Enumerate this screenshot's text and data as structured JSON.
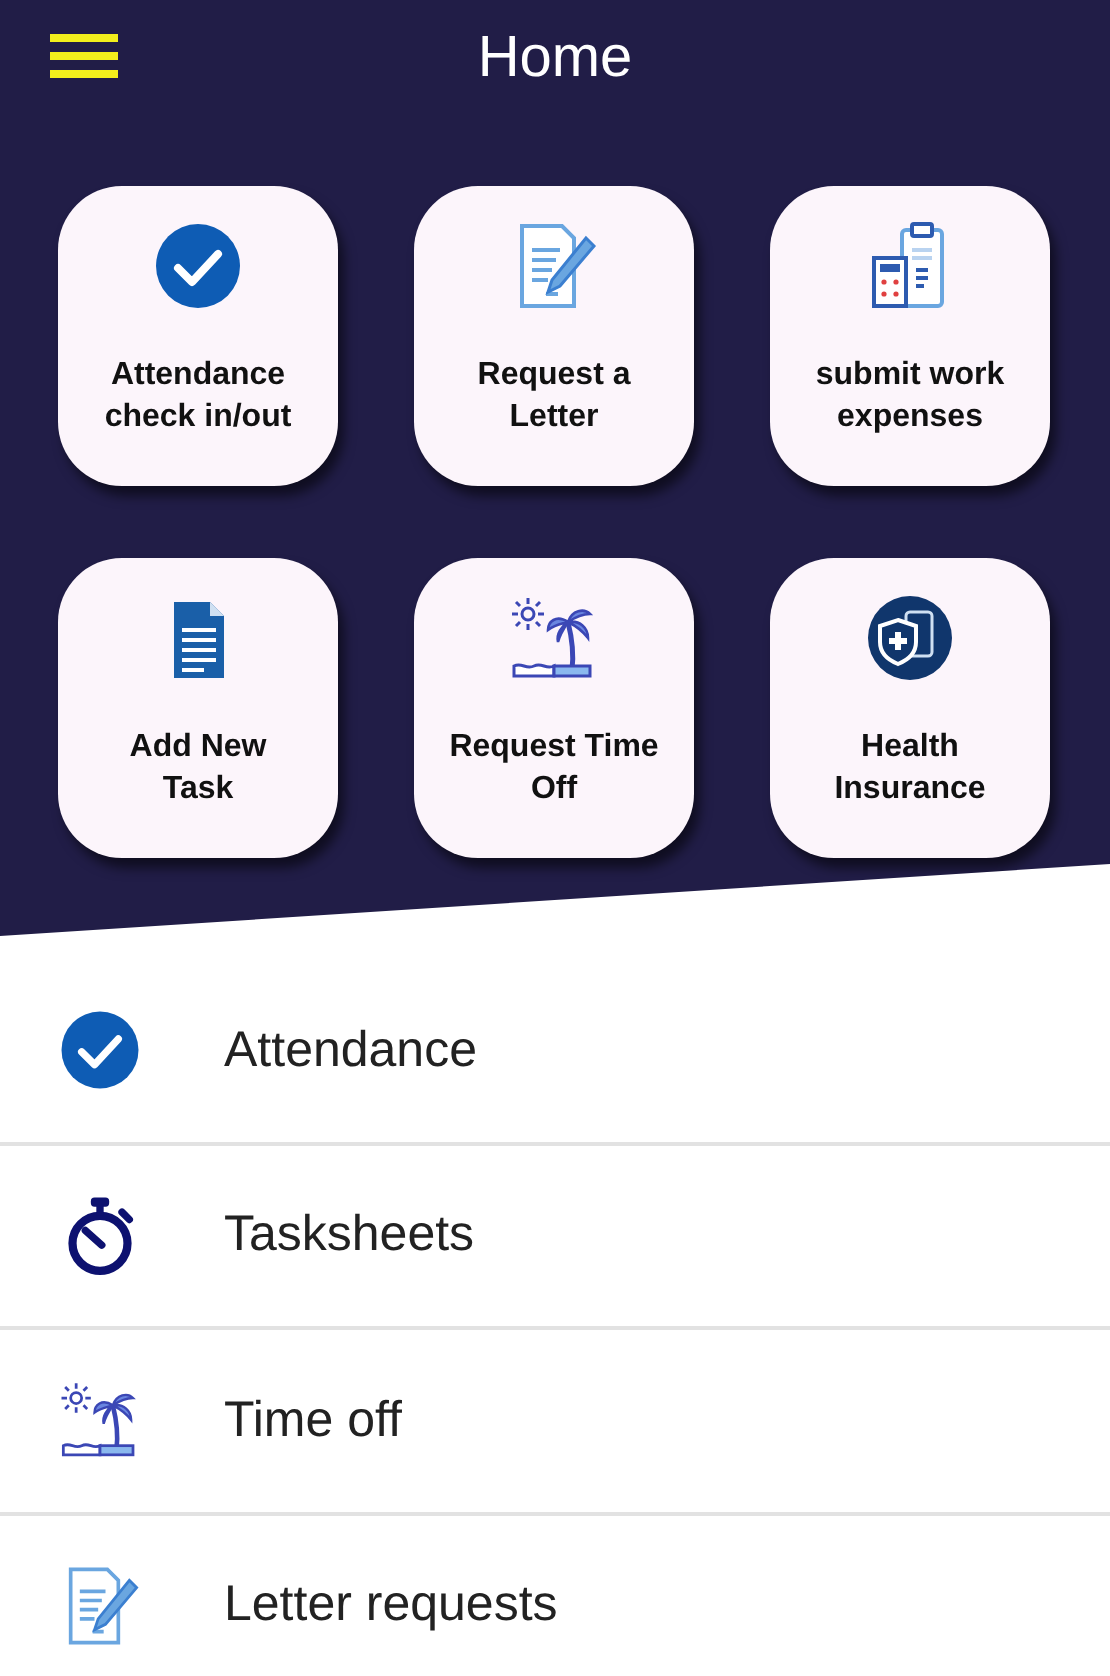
{
  "app_bar": {
    "title": "Home"
  },
  "tiles": [
    {
      "label": "Attendance check in/out",
      "kind": "check"
    },
    {
      "label": "Request a Letter",
      "kind": "letter"
    },
    {
      "label": "submit work expenses",
      "kind": "expenses"
    },
    {
      "label": "Add New Task",
      "kind": "document"
    },
    {
      "label": "Request Time Off",
      "kind": "beach"
    },
    {
      "label": "Health Insurance",
      "kind": "health"
    }
  ],
  "menu_items": [
    {
      "label": "Attendance",
      "kind": "check"
    },
    {
      "label": "Tasksheets",
      "kind": "stopwatch"
    },
    {
      "label": "Time off",
      "kind": "beach"
    },
    {
      "label": "Letter requests",
      "kind": "letter"
    }
  ]
}
